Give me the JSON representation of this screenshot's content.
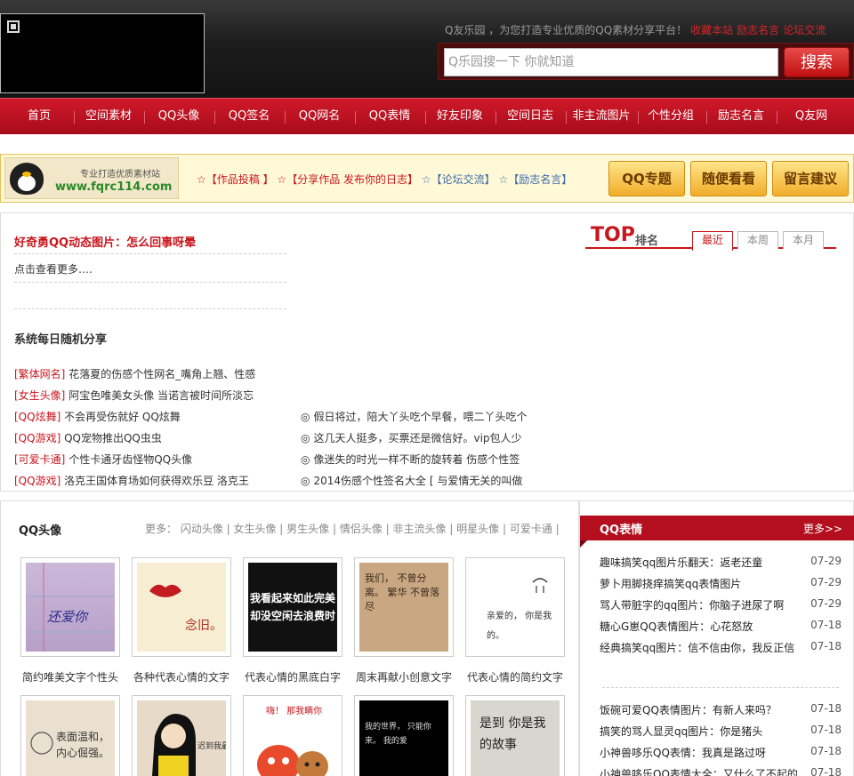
{
  "header": {
    "tagline": "Q友乐园 ，为您打造专业优质的QQ素材分享平台！",
    "tagline_links": [
      "收藏本站",
      "励志名言",
      "论坛交流"
    ],
    "search_placeholder": "Q乐园搜一下  你就知道",
    "search_button": "搜索"
  },
  "nav": [
    "首页",
    "空间素材",
    "QQ头像",
    "QQ签名",
    "QQ网名",
    "QQ表情",
    "好友印象",
    "空间日志",
    "非主流图片",
    "个性分组",
    "励志名言",
    "Q友网"
  ],
  "banner": {
    "logo_sub": "专业打造优质素材站",
    "logo_url": "www.fqrc114.com",
    "links": [
      {
        "star": "☆",
        "text": "【作品投稿 】",
        "color": "red"
      },
      {
        "star": "☆",
        "text": "【分享作品 发布你的日志】",
        "color": "red"
      },
      {
        "star": "☆",
        "text": "【论坛交流】",
        "color": "blue"
      },
      {
        "star": "☆",
        "text": "【励志名言】",
        "color": "blue"
      }
    ],
    "buttons": [
      "QQ专题",
      "随便看看",
      "留言建议"
    ]
  },
  "feature": {
    "headline": "好奇勇QQ动态图片：怎么回事呀晕",
    "more": "点击查看更多….",
    "share_title": "系统每日随机分享",
    "left_items": [
      {
        "tag": "[繁体网名]",
        "text": "花落夏的伤感个性网名_嘴角上翘、性感"
      },
      {
        "tag": "[女生头像]",
        "text": "阿宝色唯美女头像 当诺言被时间所淡忘"
      },
      {
        "tag": "[QQ炫舞]",
        "text": "不会再受伤就好 QQ炫舞"
      },
      {
        "tag": "[QQ游戏]",
        "text": "QQ宠物推出QQ虫虫"
      },
      {
        "tag": "[可爱卡通]",
        "text": "个性卡通牙齿怪物QQ头像"
      },
      {
        "tag": "[QQ游戏]",
        "text": "洛克王国体育场如何获得欢乐豆 洛克王"
      }
    ],
    "right_items": [
      "假日将过，陪大丫头吃个早餐，喂二丫头吃个",
      "这几天人挺多，买票还是微信好。vip包人少",
      "像迷失的时光一样不断的旋转着 伤感个性签",
      "2014伤感个性签名大全 [ 与爱情无关的叫做"
    ],
    "bullet": "◎"
  },
  "top": {
    "title": "TOP",
    "subtitle": "排名",
    "tabs": [
      "最近",
      "本周",
      "本月"
    ]
  },
  "avatars": {
    "title": "QQ头像",
    "more": "更多： 闪动头像 | 女生头像 | 男生头像 | 情侣头像 | 非主流头像 | 明星头像 | 可爱卡通 |",
    "captions": [
      "简约唯美文字个性头",
      "各种代表心情的文字",
      "代表心情的黑底白字",
      "周末再献小创意文字",
      "代表心情的简约文字"
    ],
    "thumb_texts": [
      "还爱你",
      "念旧。",
      "我看起来如此完美 却没空闲去浪费时",
      "我们， 不曾分离。 繁华 不曾落尽",
      "亲爱的， 你是我的。",
      "表面温和， 内心倔强。",
      "迟到我最",
      "嗨！ 那我瞒你",
      "我的世界， 只能你来。 我的爱",
      "是到 你是我的故事"
    ]
  },
  "emoticons": {
    "title": "QQ表情",
    "more": "更多>>",
    "group1": [
      {
        "title": "趣味搞笑qq图片乐翻天：返老还童",
        "date": "07-29"
      },
      {
        "title": "萝卜用脚挠痒搞笑qq表情图片",
        "date": "07-29"
      },
      {
        "title": "骂人带脏字的qq图片：你脑子进尿了啊",
        "date": "07-29"
      },
      {
        "title": "糖心G崽QQ表情图片：心花怒放",
        "date": "07-18"
      },
      {
        "title": "经典搞笑qq图片：信不信由你，我反正信",
        "date": "07-18"
      }
    ],
    "group2": [
      {
        "title": "饭碗可爱QQ表情图片：有新人来吗？",
        "date": "07-18"
      },
      {
        "title": "搞笑的骂人显灵qq图片：你是猪头",
        "date": "07-18"
      },
      {
        "title": "小神兽哆乐QQ表情：我真是路过呀",
        "date": "07-18"
      },
      {
        "title": "小神兽哆乐QQ表情大全：又什么了不起的",
        "date": "07-18"
      }
    ]
  }
}
